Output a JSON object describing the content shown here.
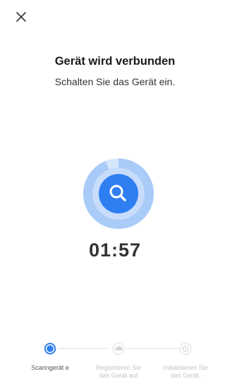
{
  "header": {
    "title": "Gerät wird verbunden",
    "subtitle": "Schalten Sie das Gerät ein."
  },
  "progress": {
    "fraction": 0.94,
    "timer": "01:57"
  },
  "steps": [
    {
      "label": "Scanngerät e",
      "state": "active",
      "icon": "search-dot-icon"
    },
    {
      "label": "Registrieren Sie das Gerät auf",
      "state": "inactive",
      "icon": "cloud-icon"
    },
    {
      "label": "Initialisieren Sie das Gerät.",
      "state": "inactive",
      "icon": "power-icon"
    }
  ],
  "colors": {
    "accent": "#2f7ff2",
    "ring_outer": "#c7ddfc",
    "ring_inner": "#8ebaf7",
    "ring_bg": "#dce9fd",
    "inactive": "#d6d6d6"
  }
}
